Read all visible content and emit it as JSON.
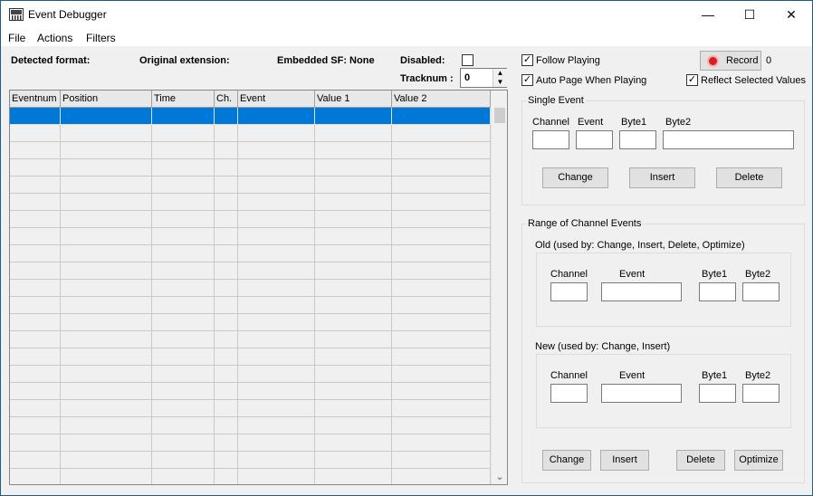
{
  "window": {
    "title": "Event Debugger",
    "minimize": "—",
    "maximize": "☐",
    "close": "✕"
  },
  "menu": {
    "file": "File",
    "actions": "Actions",
    "filters": "Filters"
  },
  "info": {
    "detected_format": "Detected format:",
    "original_extension": "Original extension:",
    "embedded_sf": "Embedded SF: None",
    "disabled": "Disabled:",
    "tracknum_label": "Tracknum :",
    "tracknum_value": "0"
  },
  "grid": {
    "columns": [
      "Eventnum",
      "Position",
      "Time",
      "Ch.",
      "Event",
      "Value 1",
      "Value 2"
    ],
    "selected_row": 0,
    "row_count": 22
  },
  "options": {
    "follow_playing": "Follow Playing",
    "follow_playing_checked": true,
    "auto_page": "Auto Page When Playing",
    "auto_page_checked": true,
    "reflect_selected": "Reflect Selected Values",
    "reflect_selected_checked": true,
    "record_label": "Record",
    "record_count": "0"
  },
  "single_event": {
    "title": "Single Event",
    "channel": "Channel",
    "event": "Event",
    "byte1": "Byte1",
    "byte2": "Byte2",
    "change": "Change",
    "insert": "Insert",
    "delete": "Delete"
  },
  "range": {
    "title": "Range of Channel Events",
    "old_title": "Old  (used by: Change, Insert, Delete, Optimize)",
    "new_title": "New  (used by: Change, Insert)",
    "channel": "Channel",
    "event": "Event",
    "byte1": "Byte1",
    "byte2": "Byte2",
    "change": "Change",
    "insert": "Insert",
    "delete": "Delete",
    "optimize": "Optimize"
  }
}
